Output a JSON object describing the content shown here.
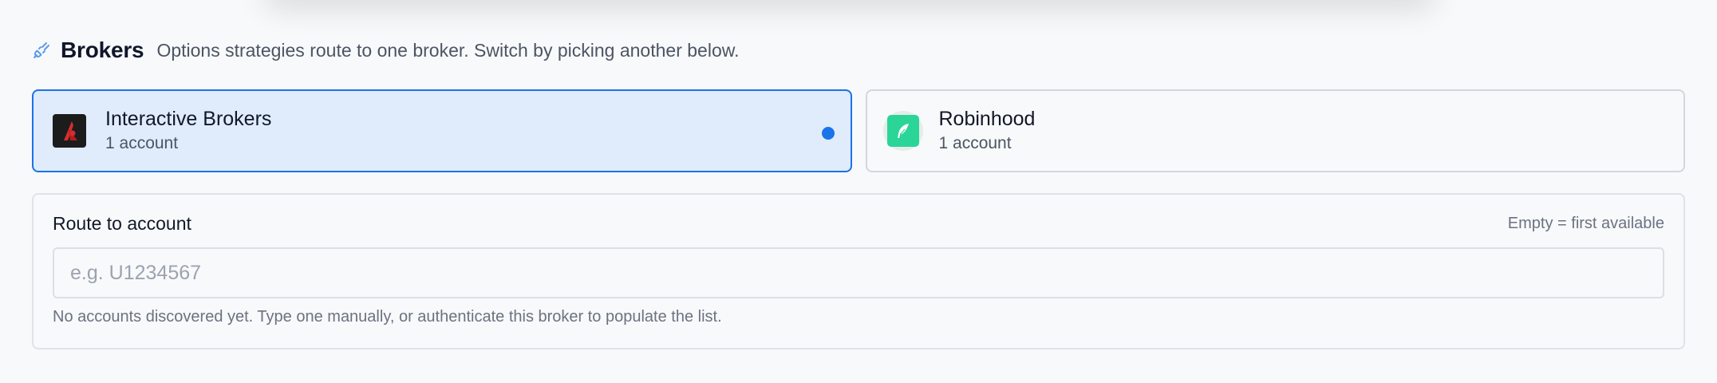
{
  "section": {
    "icon": "plug-icon",
    "title": "Brokers",
    "subtitle": "Options strategies route to one broker. Switch by picking another below."
  },
  "brokers": [
    {
      "name": "Interactive Brokers",
      "accounts": "1 account",
      "selected": true,
      "icon": "interactive-brokers-logo-icon",
      "brand_color": "#d32f2f"
    },
    {
      "name": "Robinhood",
      "accounts": "1 account",
      "selected": false,
      "icon": "robinhood-feather-logo-icon",
      "brand_color": "#2bd598"
    }
  ],
  "route": {
    "label": "Route to account",
    "hint": "Empty = first available",
    "placeholder": "e.g. U1234567",
    "value": "",
    "help": "No accounts discovered yet. Type one manually, or authenticate this broker to populate the list."
  },
  "colors": {
    "accent": "#1a73e8",
    "selected_bg": "#e0ebfc",
    "background": "#f8f9fb"
  }
}
